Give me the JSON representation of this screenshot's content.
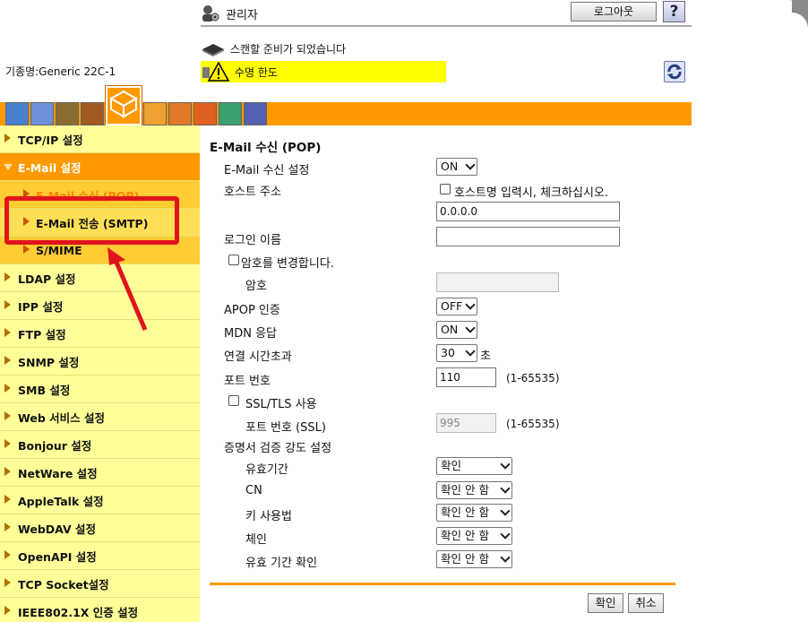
{
  "header": {
    "user_label": "관리자",
    "logout_label": "로그아웃",
    "help_label": "?",
    "status_text": "스캔할 준비가 되었습니다",
    "warning_text": "수명 한도",
    "model_label": "기종명:Generic 22C-1"
  },
  "tabs": [
    {
      "icon": "maintenance-icon"
    },
    {
      "icon": "system-icon"
    },
    {
      "icon": "security-icon"
    },
    {
      "icon": "user-auth-icon"
    },
    {
      "icon": "network-icon",
      "selected": true
    },
    {
      "icon": "box-icon"
    },
    {
      "icon": "print-settings-icon"
    },
    {
      "icon": "store-address-icon"
    },
    {
      "icon": "fax-icon"
    },
    {
      "icon": "output-icon"
    }
  ],
  "sidebar": {
    "items": [
      {
        "label": "TCP/IP 설정"
      },
      {
        "label": "E-Mail 설정"
      },
      {
        "label": "E-Mail 수신 (POP)"
      },
      {
        "label": "E-Mail 전송 (SMTP)"
      },
      {
        "label": "S/MIME"
      },
      {
        "label": "LDAP 설정"
      },
      {
        "label": "IPP 설정"
      },
      {
        "label": "FTP 설정"
      },
      {
        "label": "SNMP 설정"
      },
      {
        "label": "SMB 설정"
      },
      {
        "label": "Web 서비스 설정"
      },
      {
        "label": "Bonjour 설정"
      },
      {
        "label": "NetWare 설정"
      },
      {
        "label": "AppleTalk 설정"
      },
      {
        "label": "WebDAV 설정"
      },
      {
        "label": "OpenAPI 설정"
      },
      {
        "label": "TCP Socket설정"
      },
      {
        "label": "IEEE802.1X 인증 설정"
      }
    ]
  },
  "form": {
    "title": "E-Mail 수신 (POP)",
    "receive_label": "E-Mail 수신 설정",
    "receive_value": "ON",
    "host_label": "호스트 주소",
    "host_check_label": "호스트명 입력시, 체크하십시오.",
    "host_value": "0.0.0.0",
    "login_label": "로그인 이름",
    "login_value": "",
    "change_pw_label": "암호를 변경합니다.",
    "password_label": "암호",
    "apop_label": "APOP 인증",
    "apop_value": "OFF",
    "mdn_label": "MDN 응답",
    "mdn_value": "ON",
    "timeout_label": "연결 시간초과",
    "timeout_value": "30",
    "timeout_unit": "초",
    "port_label": "포트 번호",
    "port_value": "110",
    "port_range": "(1-65535)",
    "ssl_label": "SSL/TLS 사용",
    "ssl_port_label": "포트 번호 (SSL)",
    "ssl_port_value": "995",
    "ssl_port_range": "(1-65535)",
    "cert_label": "증명서 검증 강도 설정",
    "validity_label": "유효기간",
    "validity_value": "확인",
    "cn_label": "CN",
    "cn_value": "확인 안 함",
    "key_usage_label": "키 사용법",
    "key_usage_value": "확인 안 함",
    "chain_label": "체인",
    "chain_value": "확인 안 함",
    "expiry_label": "유효 기간 확인",
    "expiry_value": "확인 안 함",
    "ok_label": "확인",
    "cancel_label": "취소"
  },
  "colors": {
    "accent": "#ff9900",
    "sidebar_bg": "#ffff99",
    "warning_bg": "#ffff00",
    "annotation": "#e0141c"
  }
}
